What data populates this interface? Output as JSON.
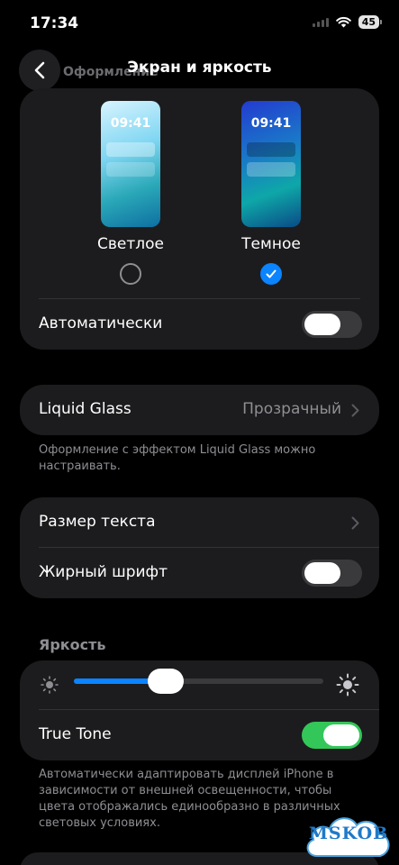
{
  "status_bar": {
    "time": "17:34",
    "battery": "45"
  },
  "nav": {
    "title": "Экран и яркость",
    "behind_header": "Оформление"
  },
  "appearance": {
    "preview_time": "09:41",
    "options": [
      {
        "label": "Светлое",
        "selected": false
      },
      {
        "label": "Темное",
        "selected": true
      }
    ],
    "automatic": {
      "label": "Автоматически",
      "on": false
    }
  },
  "liquid_glass": {
    "label": "Liquid Glass",
    "value": "Прозрачный",
    "footnote": "Оформление с эффектом Liquid Glass можно настраивать."
  },
  "text": {
    "text_size_label": "Размер текста",
    "bold_label": "Жирный шрифт",
    "bold_on": false
  },
  "brightness": {
    "header": "Яркость",
    "level": 0.37,
    "true_tone": {
      "label": "True Tone",
      "on": true
    },
    "footnote": "Автоматически адаптировать дисплей iPhone в зависимости от внешней освещенности, чтобы цвета отображались единообразно в различных световых условиях."
  },
  "watermark": {
    "text": "MSKOB"
  },
  "colors": {
    "accent": "#0a84ff",
    "toggle_on": "#33c759",
    "card": "#1c1c1e",
    "secondary_text": "#8e8e93"
  }
}
